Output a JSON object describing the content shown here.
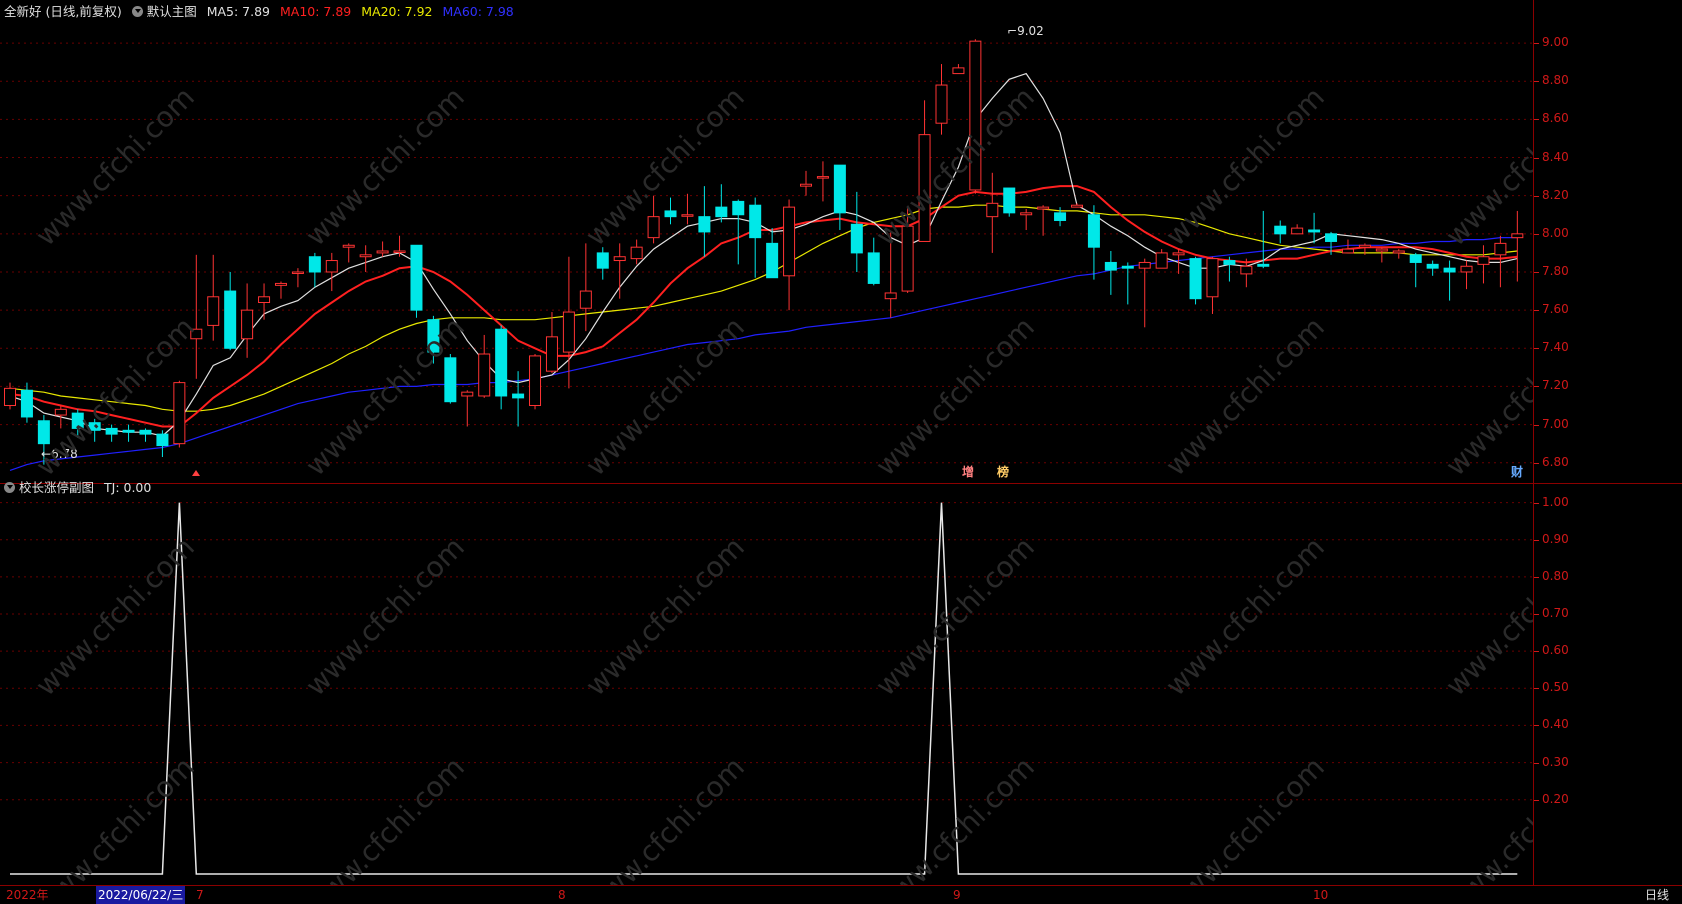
{
  "main_header": {
    "stock_title": "全新好 (日线,前复权)",
    "main_chart_label": "默认主图",
    "ma5": "MA5: 7.89",
    "ma10": "MA10: 7.89",
    "ma20": "MA20: 7.92",
    "ma60": "MA60: 7.98"
  },
  "colors": {
    "ma5": "#e0e0e0",
    "ma10": "#ff2020",
    "ma20": "#e8e800",
    "ma60": "#2020ff",
    "up": "#ff3333",
    "down": "#00e8e8",
    "axis": "#d01818",
    "grid": "#6a0000"
  },
  "icons": {
    "header_dropdown": "circle-down-icon",
    "sub_dropdown": "circle-down-icon",
    "top_right_diamond": "diamond-icon",
    "top_right_box": "window-icon",
    "limit_up_marker": "arrow-up-icon"
  },
  "price_axis": {
    "ticks": [
      "9.00",
      "8.80",
      "8.60",
      "8.40",
      "8.20",
      "8.00",
      "7.80",
      "7.60",
      "7.40",
      "7.20",
      "7.00",
      "6.80"
    ]
  },
  "sub_header": {
    "title": "校长涨停副图",
    "tj": "TJ: 0.00"
  },
  "sub_axis": {
    "ticks": [
      "1.00",
      "0.90",
      "0.80",
      "0.70",
      "0.60",
      "0.50",
      "0.40",
      "0.30",
      "0.20"
    ]
  },
  "annotations": {
    "high_label": "9.02",
    "low_label": "6.78",
    "marker_zeng": "增",
    "marker_bang": "榜",
    "marker_cai": "财"
  },
  "bottom_bar": {
    "year": "2022年",
    "cursor_date": "2022/06/22/三",
    "month_7": "7",
    "month_8": "8",
    "month_9": "9",
    "month_10": "10",
    "period": "日线"
  },
  "watermark": "www.cfchi.com",
  "chart_data": {
    "type": "candlestick",
    "price_ylim": [
      6.72,
      9.1
    ],
    "indicator_ylim": [
      0,
      1.05
    ],
    "candles": [
      [
        7.1,
        7.19,
        7.22,
        7.08
      ],
      [
        7.18,
        7.04,
        7.22,
        7.01
      ],
      [
        7.02,
        6.9,
        7.05,
        6.79
      ],
      [
        7.05,
        7.08,
        7.1,
        6.98
      ],
      [
        7.06,
        6.98,
        7.08,
        6.93
      ],
      [
        7.01,
        6.97,
        7.03,
        6.91
      ],
      [
        6.98,
        6.95,
        7.0,
        6.91
      ],
      [
        6.97,
        6.96,
        7.0,
        6.91
      ],
      [
        6.97,
        6.95,
        6.98,
        6.91
      ],
      [
        6.95,
        6.89,
        6.97,
        6.83
      ],
      [
        6.9,
        7.22,
        7.23,
        6.88
      ],
      [
        7.45,
        7.5,
        7.89,
        7.24
      ],
      [
        7.52,
        7.67,
        7.89,
        7.44
      ],
      [
        7.7,
        7.4,
        7.8,
        7.39
      ],
      [
        7.45,
        7.6,
        7.74,
        7.35
      ],
      [
        7.64,
        7.67,
        7.74,
        7.55
      ],
      [
        7.73,
        7.74,
        7.75,
        7.66
      ],
      [
        7.8,
        7.8,
        7.82,
        7.72
      ],
      [
        7.88,
        7.8,
        7.9,
        7.72
      ],
      [
        7.8,
        7.86,
        7.9,
        7.7
      ],
      [
        7.93,
        7.94,
        7.95,
        7.85
      ],
      [
        7.88,
        7.89,
        7.94,
        7.8
      ],
      [
        7.9,
        7.91,
        7.96,
        7.88
      ],
      [
        7.91,
        7.91,
        7.99,
        7.88
      ],
      [
        7.94,
        7.6,
        7.94,
        7.56
      ],
      [
        7.55,
        7.38,
        7.57,
        7.32
      ],
      [
        7.35,
        7.12,
        7.37,
        7.11
      ],
      [
        7.15,
        7.17,
        7.18,
        6.99
      ],
      [
        7.15,
        7.37,
        7.47,
        7.14
      ],
      [
        7.5,
        7.15,
        7.52,
        7.08
      ],
      [
        7.16,
        7.14,
        7.28,
        6.99
      ],
      [
        7.1,
        7.36,
        7.37,
        7.08
      ],
      [
        7.28,
        7.46,
        7.59,
        7.27
      ],
      [
        7.38,
        7.59,
        7.88,
        7.19
      ],
      [
        7.61,
        7.7,
        7.95,
        7.49
      ],
      [
        7.9,
        7.82,
        7.93,
        7.76
      ],
      [
        7.86,
        7.88,
        7.95,
        7.66
      ],
      [
        7.87,
        7.93,
        7.97,
        7.84
      ],
      [
        7.98,
        8.09,
        8.2,
        7.95
      ],
      [
        8.12,
        8.09,
        8.19,
        8.05
      ],
      [
        8.1,
        8.1,
        8.21,
        8.05
      ],
      [
        8.09,
        8.01,
        8.25,
        7.88
      ],
      [
        8.14,
        8.09,
        8.26,
        8.06
      ],
      [
        8.17,
        8.1,
        8.18,
        7.84
      ],
      [
        8.15,
        7.98,
        8.19,
        7.77
      ],
      [
        7.95,
        7.77,
        8.03,
        7.79
      ],
      [
        7.78,
        8.14,
        8.18,
        7.6
      ],
      [
        8.25,
        8.26,
        8.33,
        8.2
      ],
      [
        8.3,
        8.3,
        8.38,
        8.17
      ],
      [
        8.36,
        8.11,
        8.36,
        8.02
      ],
      [
        8.05,
        7.9,
        8.22,
        7.8
      ],
      [
        7.9,
        7.74,
        7.98,
        7.73
      ],
      [
        7.66,
        7.69,
        8.01,
        7.56
      ],
      [
        7.7,
        8.04,
        8.14,
        7.69
      ],
      [
        7.96,
        8.52,
        8.7,
        8.05
      ],
      [
        8.58,
        8.78,
        8.89,
        8.52
      ],
      [
        8.84,
        8.87,
        8.89,
        8.84
      ],
      [
        8.23,
        9.01,
        9.02,
        8.21
      ],
      [
        8.09,
        8.16,
        8.32,
        7.9
      ],
      [
        8.24,
        8.11,
        8.24,
        8.09
      ],
      [
        8.1,
        8.11,
        8.13,
        8.02
      ],
      [
        8.13,
        8.14,
        8.15,
        7.99
      ],
      [
        8.11,
        8.07,
        8.14,
        8.04
      ],
      [
        8.14,
        8.15,
        8.16,
        8.14
      ],
      [
        8.1,
        7.93,
        8.15,
        7.76
      ],
      [
        7.85,
        7.81,
        7.91,
        7.68
      ],
      [
        7.83,
        7.82,
        7.85,
        7.63
      ],
      [
        7.82,
        7.85,
        7.87,
        7.51
      ],
      [
        7.82,
        7.9,
        7.92,
        7.83
      ],
      [
        7.89,
        7.9,
        7.92,
        7.79
      ],
      [
        7.87,
        7.66,
        7.88,
        7.63
      ],
      [
        7.67,
        7.87,
        7.88,
        7.58
      ],
      [
        7.86,
        7.84,
        7.88,
        7.75
      ],
      [
        7.79,
        7.83,
        7.87,
        7.72
      ],
      [
        7.84,
        7.83,
        8.12,
        7.82
      ],
      [
        8.04,
        8.0,
        8.07,
        7.95
      ],
      [
        8.0,
        8.03,
        8.05,
        8.0
      ],
      [
        8.02,
        8.01,
        8.11,
        7.95
      ],
      [
        8.0,
        7.96,
        8.01,
        7.89
      ],
      [
        7.9,
        7.92,
        7.97,
        7.9
      ],
      [
        7.93,
        7.94,
        7.95,
        7.89
      ],
      [
        7.91,
        7.92,
        7.93,
        7.85
      ],
      [
        7.9,
        7.91,
        7.92,
        7.87
      ],
      [
        7.89,
        7.85,
        7.9,
        7.72
      ],
      [
        7.84,
        7.82,
        7.86,
        7.78
      ],
      [
        7.82,
        7.8,
        7.86,
        7.65
      ],
      [
        7.8,
        7.83,
        7.86,
        7.71
      ],
      [
        7.84,
        7.88,
        7.94,
        7.74
      ],
      [
        7.89,
        7.95,
        7.99,
        7.72
      ],
      [
        7.98,
        8.0,
        8.12,
        7.75
      ]
    ],
    "ma5": [
      7.15,
      7.12,
      7.06,
      7.04,
      7.02,
      6.98,
      6.97,
      6.96,
      6.96,
      6.94,
      7.02,
      7.16,
      7.31,
      7.35,
      7.47,
      7.58,
      7.62,
      7.65,
      7.72,
      7.77,
      7.82,
      7.85,
      7.88,
      7.9,
      7.85,
      7.71,
      7.58,
      7.44,
      7.33,
      7.24,
      7.22,
      7.24,
      7.26,
      7.34,
      7.45,
      7.59,
      7.72,
      7.83,
      7.92,
      7.98,
      8.04,
      8.06,
      8.08,
      8.08,
      8.06,
      8.01,
      8.02,
      8.05,
      8.09,
      8.12,
      8.1,
      8.06,
      7.98,
      7.94,
      7.98,
      8.17,
      8.35,
      8.6,
      8.71,
      8.81,
      8.84,
      8.71,
      8.53,
      8.15,
      8.1,
      8.04,
      7.99,
      7.93,
      7.88,
      7.85,
      7.82,
      7.82,
      7.84,
      7.83,
      7.86,
      7.92,
      7.94,
      7.96,
      8.0,
      7.99,
      7.98,
      7.97,
      7.95,
      7.92,
      7.9,
      7.88,
      7.86,
      7.85,
      7.85,
      7.87
    ],
    "ma10": [
      7.16,
      7.15,
      7.12,
      7.1,
      7.08,
      7.07,
      7.05,
      7.03,
      7.01,
      6.99,
      6.99,
      7.06,
      7.14,
      7.2,
      7.26,
      7.33,
      7.42,
      7.5,
      7.58,
      7.64,
      7.7,
      7.75,
      7.78,
      7.82,
      7.83,
      7.8,
      7.75,
      7.68,
      7.6,
      7.52,
      7.44,
      7.4,
      7.36,
      7.36,
      7.38,
      7.41,
      7.48,
      7.55,
      7.64,
      7.74,
      7.82,
      7.88,
      7.95,
      7.98,
      8.02,
      8.02,
      8.04,
      8.06,
      8.07,
      8.08,
      8.06,
      8.05,
      8.04,
      8.04,
      8.08,
      8.14,
      8.2,
      8.22,
      8.21,
      8.21,
      8.22,
      8.24,
      8.25,
      8.25,
      8.22,
      8.14,
      8.07,
      8.01,
      7.96,
      7.92,
      7.89,
      7.87,
      7.86,
      7.85,
      7.86,
      7.87,
      7.87,
      7.89,
      7.91,
      7.92,
      7.93,
      7.93,
      7.93,
      7.93,
      7.92,
      7.9,
      7.88,
      7.87,
      7.87,
      7.88
    ],
    "ma20": [
      7.19,
      7.18,
      7.17,
      7.15,
      7.14,
      7.13,
      7.12,
      7.11,
      7.1,
      7.08,
      7.07,
      7.07,
      7.08,
      7.1,
      7.13,
      7.16,
      7.2,
      7.24,
      7.28,
      7.32,
      7.37,
      7.41,
      7.46,
      7.5,
      7.53,
      7.55,
      7.56,
      7.56,
      7.56,
      7.55,
      7.55,
      7.55,
      7.56,
      7.57,
      7.58,
      7.59,
      7.6,
      7.61,
      7.62,
      7.64,
      7.66,
      7.68,
      7.7,
      7.73,
      7.76,
      7.8,
      7.85,
      7.9,
      7.95,
      7.99,
      8.03,
      8.06,
      8.08,
      8.1,
      8.13,
      8.14,
      8.14,
      8.15,
      8.15,
      8.14,
      8.14,
      8.13,
      8.12,
      8.12,
      8.11,
      8.1,
      8.1,
      8.1,
      8.09,
      8.08,
      8.06,
      8.03,
      8.0,
      7.98,
      7.96,
      7.94,
      7.93,
      7.92,
      7.91,
      7.9,
      7.9,
      7.9,
      7.9,
      7.89,
      7.89,
      7.89,
      7.89,
      7.89,
      7.9,
      7.91
    ],
    "ma60": [
      6.76,
      6.79,
      6.81,
      6.82,
      6.83,
      6.84,
      6.85,
      6.86,
      6.87,
      6.88,
      6.9,
      6.93,
      6.96,
      6.99,
      7.02,
      7.05,
      7.08,
      7.11,
      7.13,
      7.15,
      7.17,
      7.18,
      7.19,
      7.2,
      7.2,
      7.21,
      7.21,
      7.21,
      7.22,
      7.22,
      7.23,
      7.24,
      7.26,
      7.28,
      7.3,
      7.32,
      7.34,
      7.36,
      7.38,
      7.4,
      7.42,
      7.43,
      7.44,
      7.45,
      7.47,
      7.48,
      7.49,
      7.51,
      7.52,
      7.53,
      7.54,
      7.55,
      7.56,
      7.58,
      7.6,
      7.62,
      7.64,
      7.66,
      7.68,
      7.7,
      7.72,
      7.74,
      7.76,
      7.78,
      7.79,
      7.81,
      7.83,
      7.84,
      7.85,
      7.86,
      7.87,
      7.88,
      7.89,
      7.9,
      7.91,
      7.92,
      7.92,
      7.93,
      7.93,
      7.94,
      7.94,
      7.94,
      7.95,
      7.95,
      7.96,
      7.96,
      7.97,
      7.97,
      7.98,
      7.98
    ],
    "tj": [
      0,
      0,
      0,
      0,
      0,
      0,
      0,
      0,
      0,
      0,
      1,
      0,
      0,
      0,
      0,
      0,
      0,
      0,
      0,
      0,
      0,
      0,
      0,
      0,
      0,
      0,
      0,
      0,
      0,
      0,
      0,
      0,
      0,
      0,
      0,
      0,
      0,
      0,
      0,
      0,
      0,
      0,
      0,
      0,
      0,
      0,
      0,
      0,
      0,
      0,
      0,
      0,
      0,
      0,
      0,
      1,
      0,
      0,
      0,
      0,
      0,
      0,
      0,
      0,
      0,
      0,
      0,
      0,
      0,
      0,
      0,
      0,
      0,
      0,
      0,
      0,
      0,
      0,
      0,
      0,
      0,
      0,
      0,
      0,
      0,
      0,
      0,
      0,
      0,
      0
    ]
  }
}
